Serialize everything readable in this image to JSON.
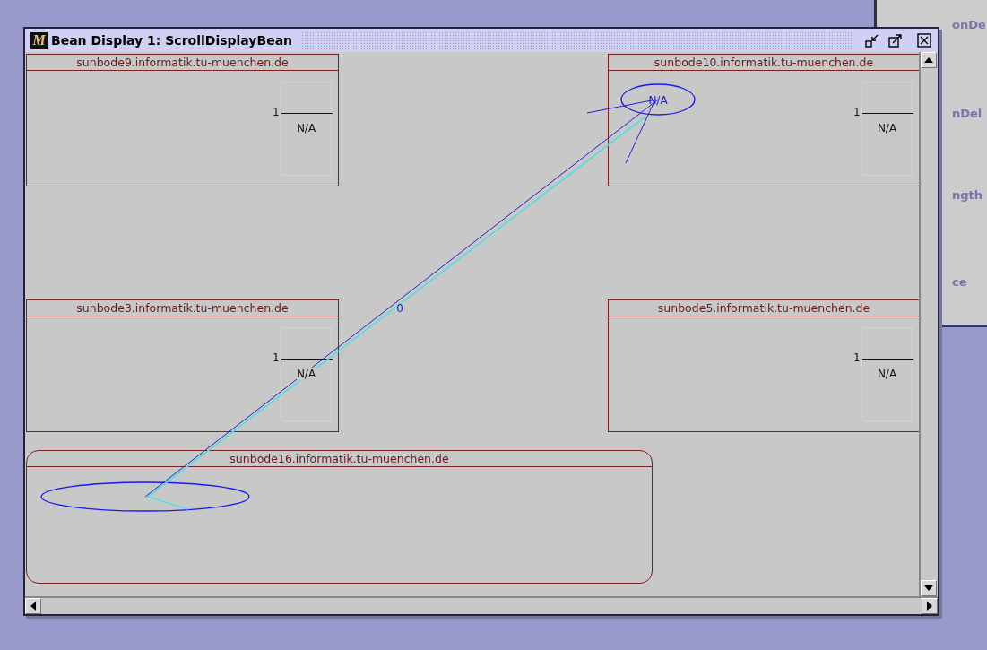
{
  "background_window": {
    "labels": [
      "onDe",
      "nDel",
      "ngth",
      "ce"
    ]
  },
  "window": {
    "logo": "M",
    "title": "Bean Display 1: ScrollDisplayBean"
  },
  "hosts": [
    {
      "name": "sunbode9.informatik.tu-muenchen.de",
      "rounded": false,
      "meter": {
        "scale": "1",
        "value": "N/A"
      }
    },
    {
      "name": "sunbode10.informatik.tu-muenchen.de",
      "rounded": false,
      "meter": {
        "scale": "1",
        "value": "N/A"
      }
    },
    {
      "name": "sunbode3.informatik.tu-muenchen.de",
      "rounded": false,
      "meter": {
        "scale": "1",
        "value": "N/A"
      }
    },
    {
      "name": "sunbode5.informatik.tu-muenchen.de",
      "rounded": false,
      "meter": {
        "scale": "1",
        "value": "N/A"
      }
    },
    {
      "name": "sunbode16.informatik.tu-muenchen.de",
      "rounded": true
    }
  ],
  "graph": {
    "target_label": "N/A",
    "edge_label": "0"
  }
}
